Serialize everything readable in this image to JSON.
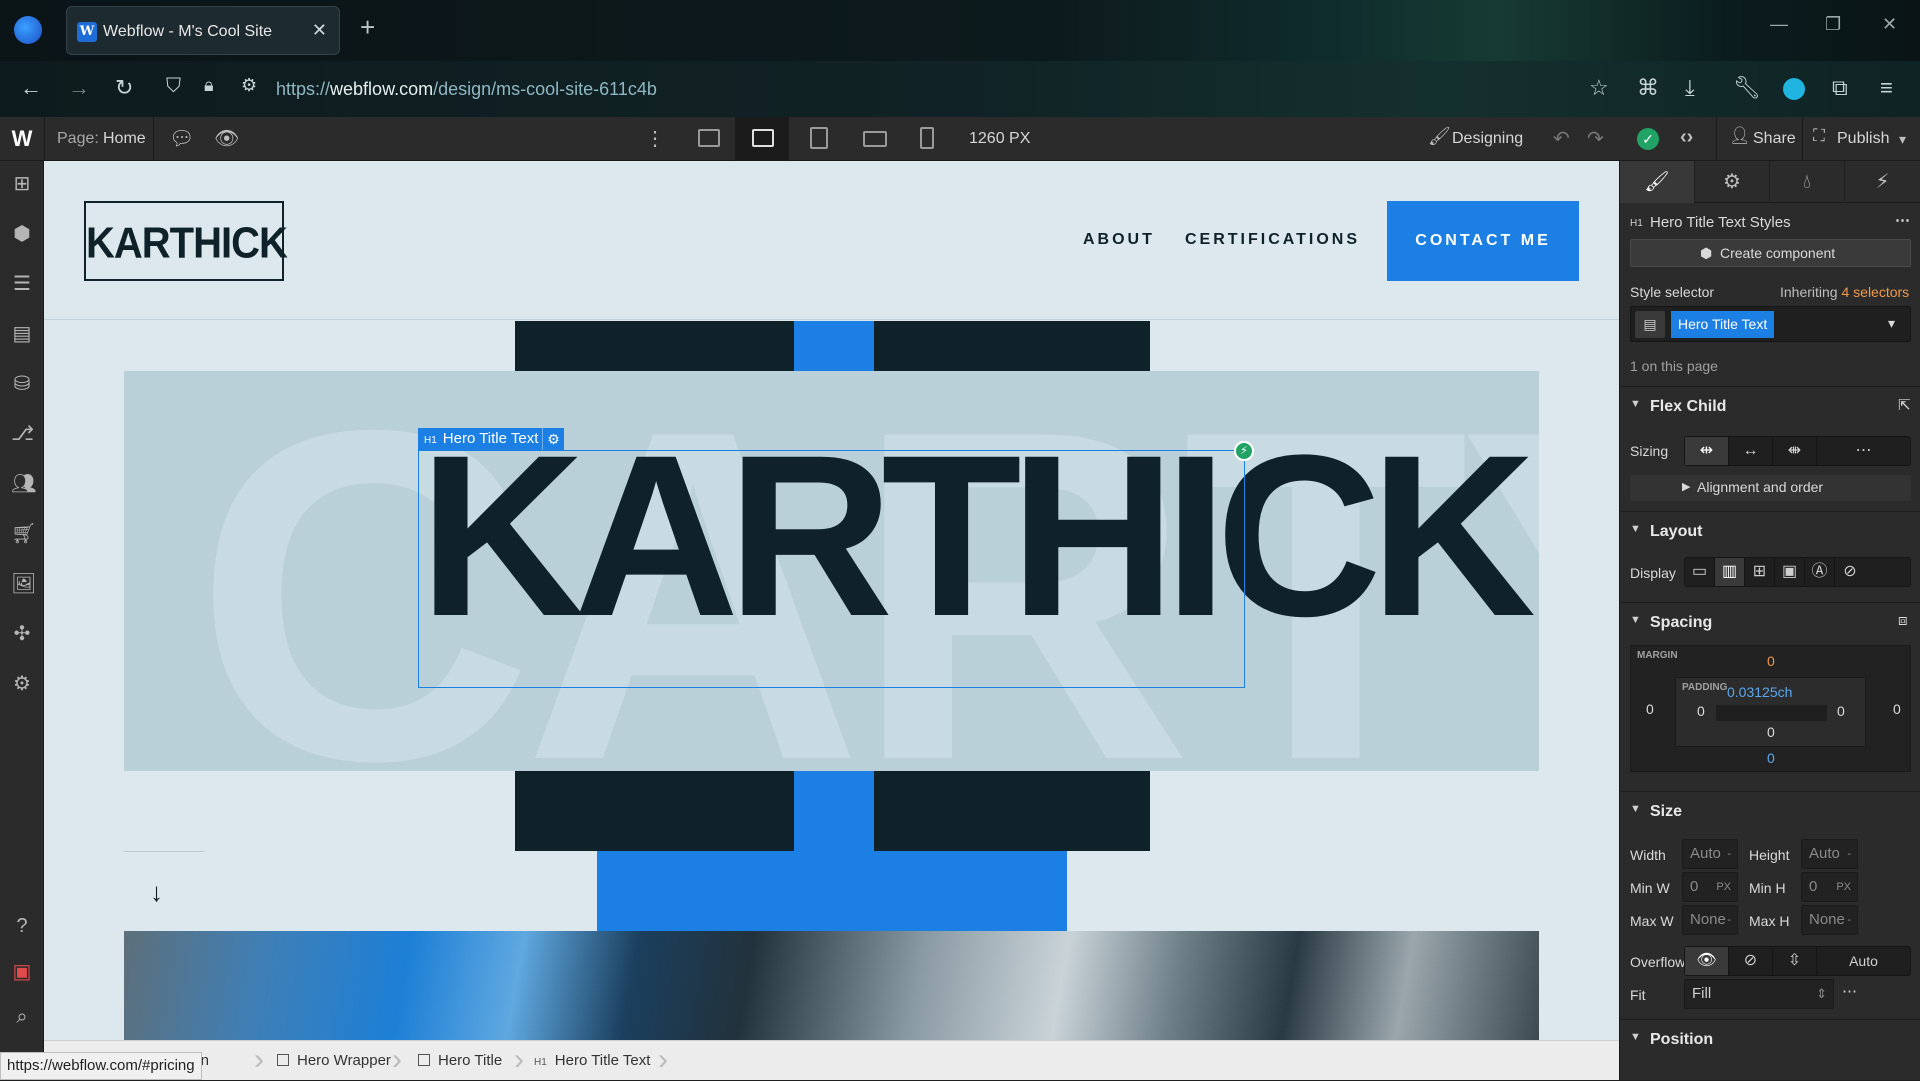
{
  "browser": {
    "tab_title": "Webflow - M's Cool Site",
    "tab_icon": "W",
    "url_prefix": "https://",
    "url_host": "webflow.com",
    "url_path": "/design/ms-cool-site-611c4b",
    "status_url": "https://webflow.com/#pricing"
  },
  "topbar": {
    "page_label": "Page:",
    "page_name": "Home",
    "width_value": "1260 PX",
    "mode_label": "Designing",
    "share_label": "Share",
    "publish_label": "Publish"
  },
  "site": {
    "logo_text": "KARTHICK",
    "nav": [
      "ABOUT",
      "CERTIFICATIONS"
    ],
    "contact_label": "CONTACT ME",
    "background_word": "CARTY",
    "hero_title": "KARTHICK",
    "arrow": "↓"
  },
  "selection": {
    "tag": "H1",
    "label": "Hero Title Text"
  },
  "breadcrumb": [
    {
      "label": "ection",
      "icon": "section"
    },
    {
      "label": "Hero Wrapper",
      "icon": "div"
    },
    {
      "label": "Hero Title",
      "icon": "div"
    },
    {
      "label": "Hero Title Text",
      "icon": "H1"
    }
  ],
  "panel": {
    "element_tag": "H1",
    "element_title": "Hero Title Text Styles",
    "create_component": "Create component",
    "style_selector_label": "Style selector",
    "inheriting_prefix": "Inheriting",
    "inheriting_count": "4 selectors",
    "selector_chip": "Hero Title Text",
    "on_page": "1 on this page",
    "flex_child": {
      "title": "Flex Child",
      "sizing_label": "Sizing",
      "alignment": "Alignment and order"
    },
    "layout": {
      "title": "Layout",
      "display_label": "Display"
    },
    "spacing": {
      "title": "Spacing",
      "margin_label": "MARGIN",
      "padding_label": "PADDING",
      "margin_top": "0",
      "margin_left": "0",
      "margin_right": "0",
      "margin_bottom": "0",
      "padding_top": "0.03125ch",
      "padding_left": "0",
      "padding_right": "0",
      "padding_bottom": "0"
    },
    "size": {
      "title": "Size",
      "width_label": "Width",
      "width_value": "Auto",
      "height_label": "Height",
      "height_value": "Auto",
      "minw_label": "Min W",
      "minw_value": "0",
      "minh_label": "Min H",
      "minh_value": "0",
      "maxw_label": "Max W",
      "maxw_value": "None",
      "maxh_label": "Max H",
      "maxh_value": "None",
      "unit_px": "PX",
      "unit_dash": "-",
      "overflow_label": "Overflow",
      "overflow_auto": "Auto",
      "fit_label": "Fit",
      "fit_value": "Fill"
    },
    "position_title": "Position"
  },
  "colors": {
    "accent": "#1b7fe3",
    "dark": "#0f2229",
    "canvas_bg": "#dce8ee",
    "orange": "#f2994a",
    "green": "#21a366"
  }
}
